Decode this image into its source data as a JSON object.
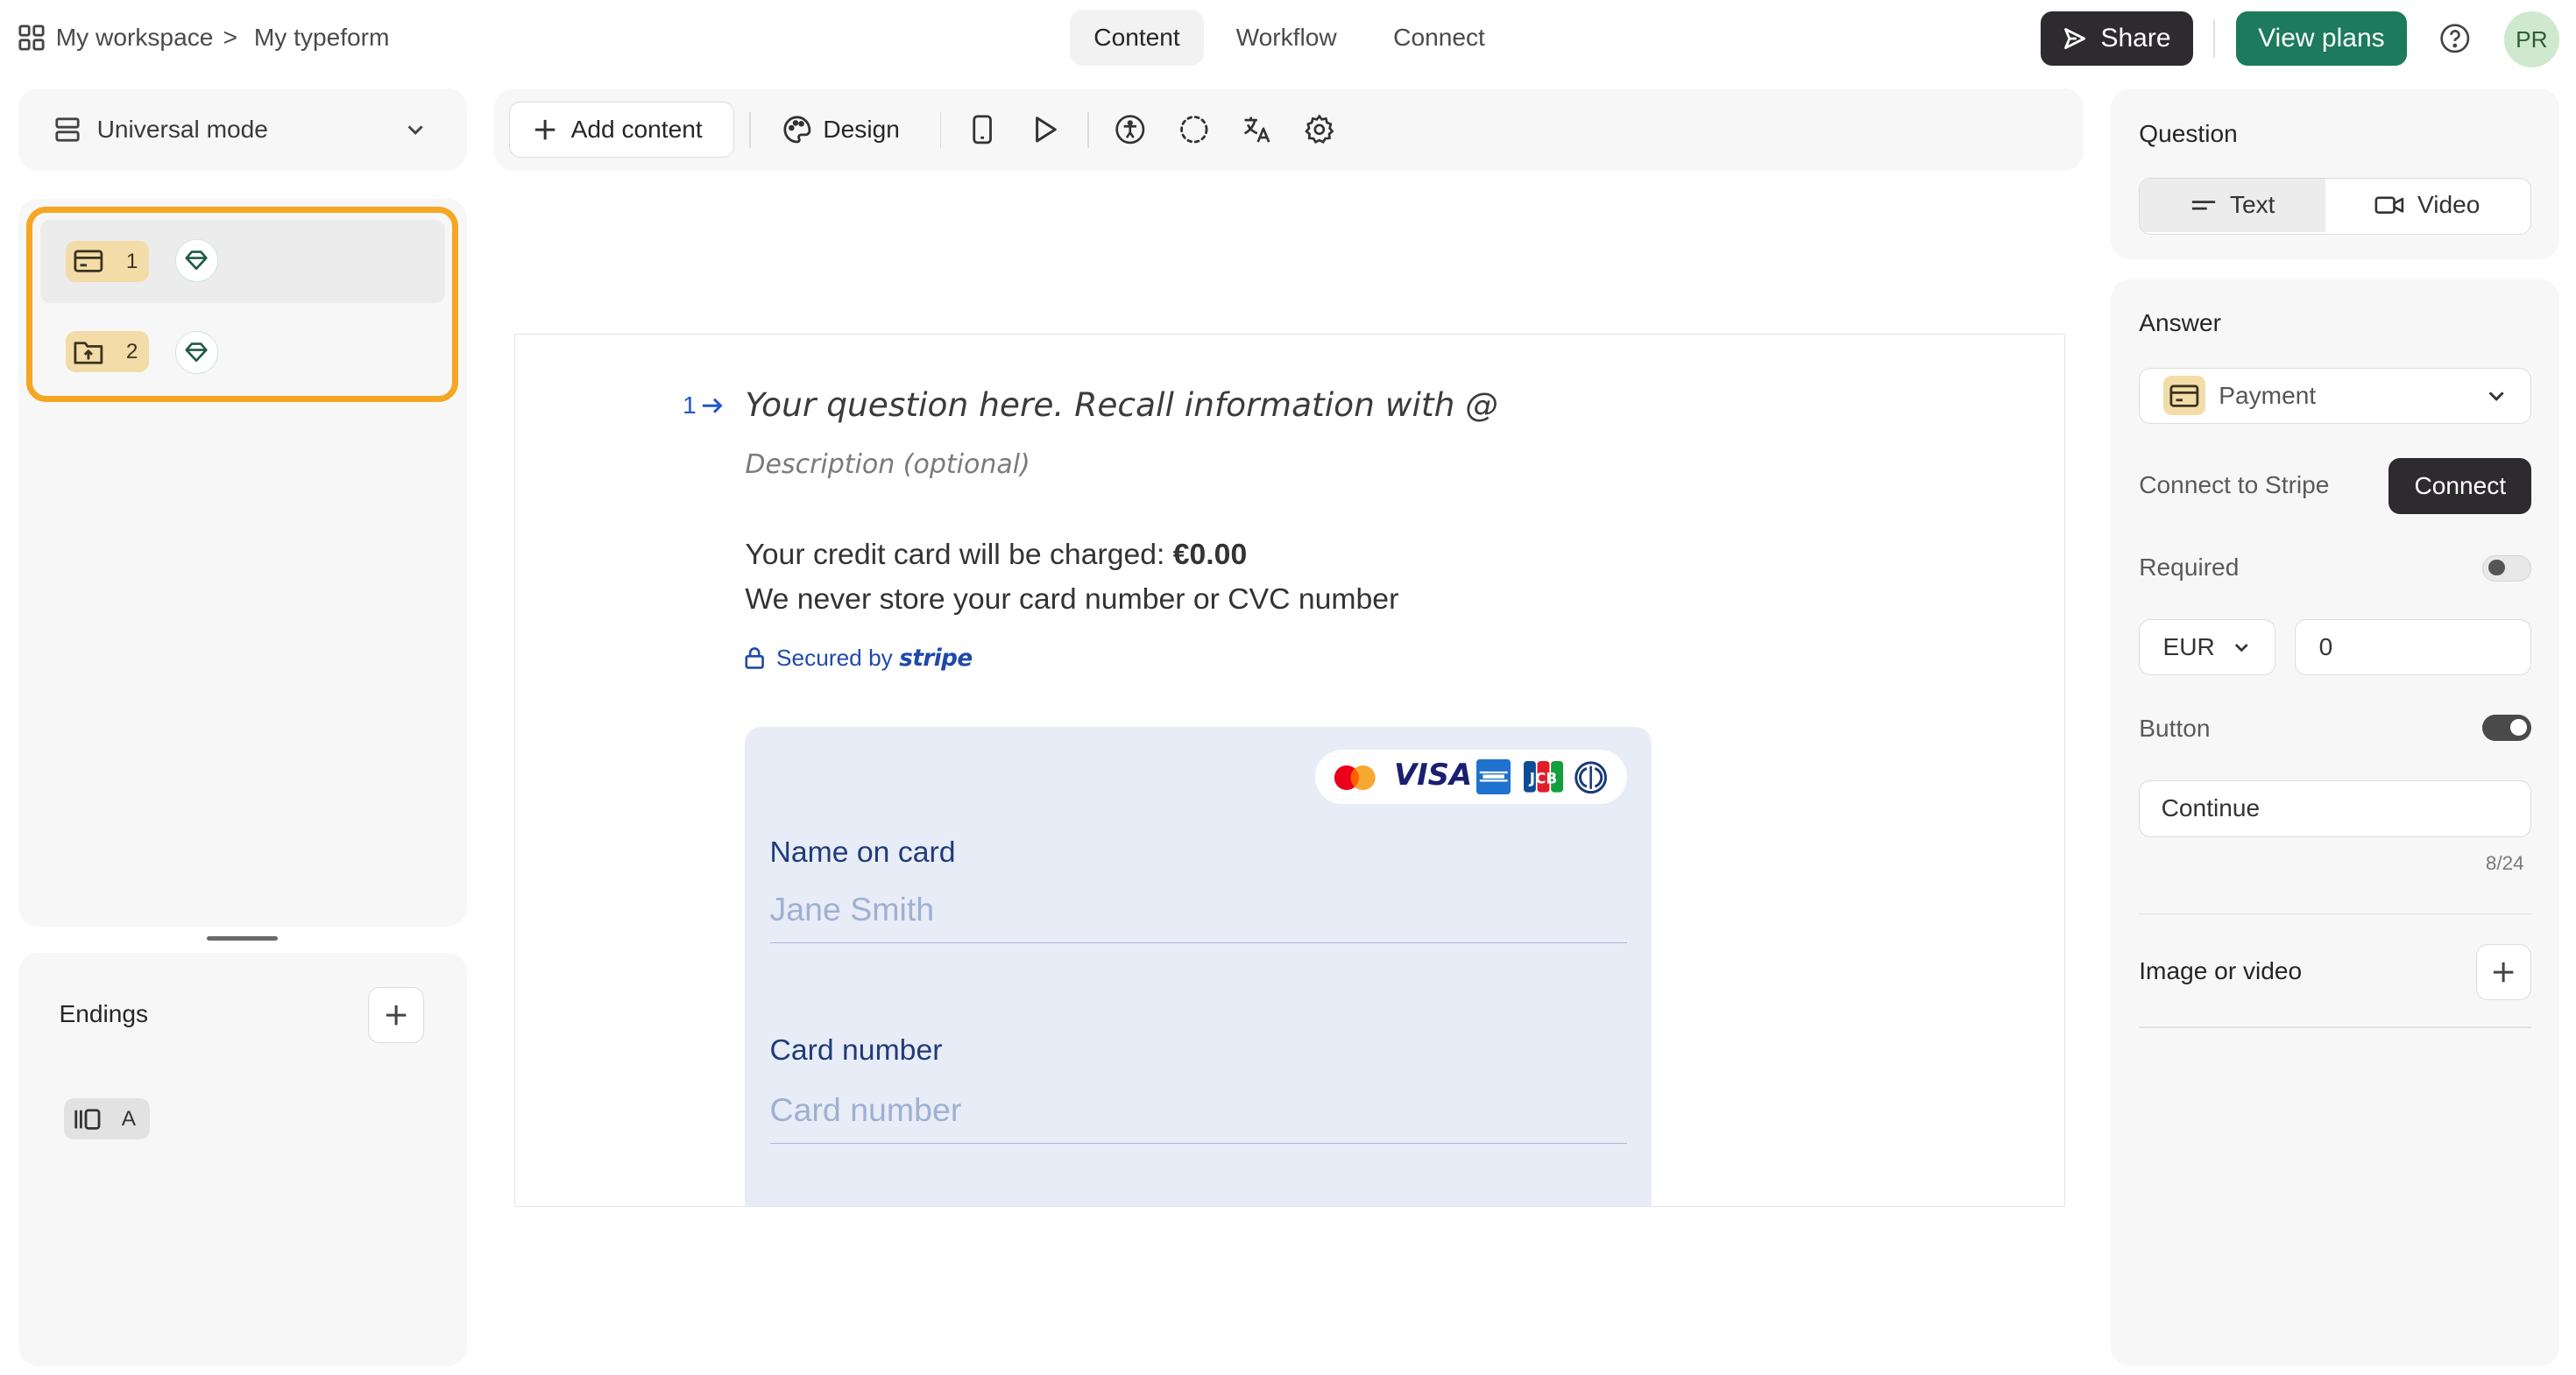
{
  "header": {
    "workspace": "My workspace",
    "separator": ">",
    "form_name": "My typeform",
    "tabs": [
      {
        "label": "Content",
        "active": true
      },
      {
        "label": "Workflow",
        "active": false
      },
      {
        "label": "Connect",
        "active": false
      }
    ],
    "share_label": "Share",
    "view_plans_label": "View plans",
    "avatar_initials": "PR"
  },
  "left_panel": {
    "mode_label": "Universal mode",
    "questions": [
      {
        "number": "1",
        "type_icon": "payment-card-icon",
        "badge_icon": "diamond-icon"
      },
      {
        "number": "2",
        "type_icon": "file-upload-icon",
        "badge_icon": "diamond-icon"
      }
    ],
    "endings_title": "Endings",
    "endings": [
      {
        "letter": "A",
        "icon": "ending-icon"
      }
    ]
  },
  "toolbar": {
    "add_content_label": "Add content",
    "design_label": "Design",
    "icons": [
      "phone-preview-icon",
      "play-icon",
      "accessibility-icon",
      "loading-icon",
      "translate-icon",
      "settings-icon"
    ]
  },
  "canvas": {
    "question_number": "1",
    "question_placeholder": "Your question here. Recall information with @",
    "description_placeholder": "Description (optional)",
    "charge_prefix": "Your credit card will be charged: ",
    "charge_amount": "€0.00",
    "storage_note": "We never store your card number or CVC number",
    "secured_by": "Secured by",
    "stripe": "stripe",
    "card_brands": [
      "mastercard",
      "VISA",
      "amex",
      "JCB",
      "diners"
    ],
    "name_label": "Name on card",
    "name_placeholder": "Jane Smith",
    "card_label": "Card number",
    "card_placeholder": "Card number"
  },
  "right_panel": {
    "question_title": "Question",
    "text_option": "Text",
    "video_option": "Video",
    "answer_title": "Answer",
    "answer_type": "Payment",
    "connect_stripe_label": "Connect to Stripe",
    "connect_button": "Connect",
    "required_label": "Required",
    "required_on": false,
    "currency": "EUR",
    "amount": "0",
    "button_label": "Button",
    "button_on": true,
    "button_text": "Continue",
    "button_counter": "8/24",
    "image_video_label": "Image or video"
  },
  "colors": {
    "highlight": "#f5a623",
    "green": "#1d7a5c",
    "dark": "#2d2a30",
    "stripe_blue": "#1f4aa8"
  }
}
